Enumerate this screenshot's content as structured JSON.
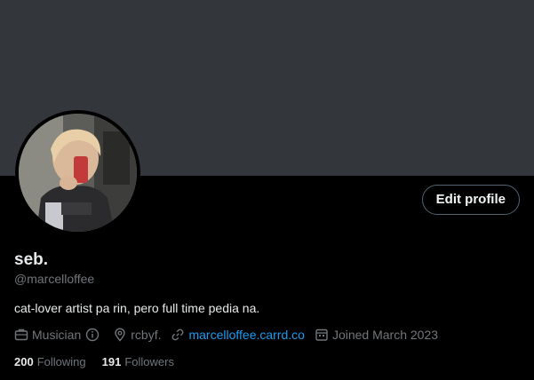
{
  "profile": {
    "name": "seb.",
    "handle": "@marcelloffee",
    "bio": "cat-lover artist pa rin, pero full time pedia na.",
    "edit_label": "Edit profile",
    "avatar_alt": "profile photo"
  },
  "meta": {
    "category": "Musician",
    "location": "rcbyf.",
    "website": "marcelloffee.carrd.co",
    "joined": "Joined March 2023"
  },
  "stats": {
    "following_count": "200",
    "following_label": "Following",
    "followers_count": "191",
    "followers_label": "Followers"
  },
  "colors": {
    "banner": "#33363a",
    "background": "#000000",
    "link": "#1d9bf0",
    "muted": "#71767b",
    "text": "#e7e9ea"
  },
  "icons": {
    "category": "briefcase-icon",
    "info": "info-icon",
    "location": "location-pin-icon",
    "website": "link-icon",
    "joined": "calendar-icon"
  }
}
